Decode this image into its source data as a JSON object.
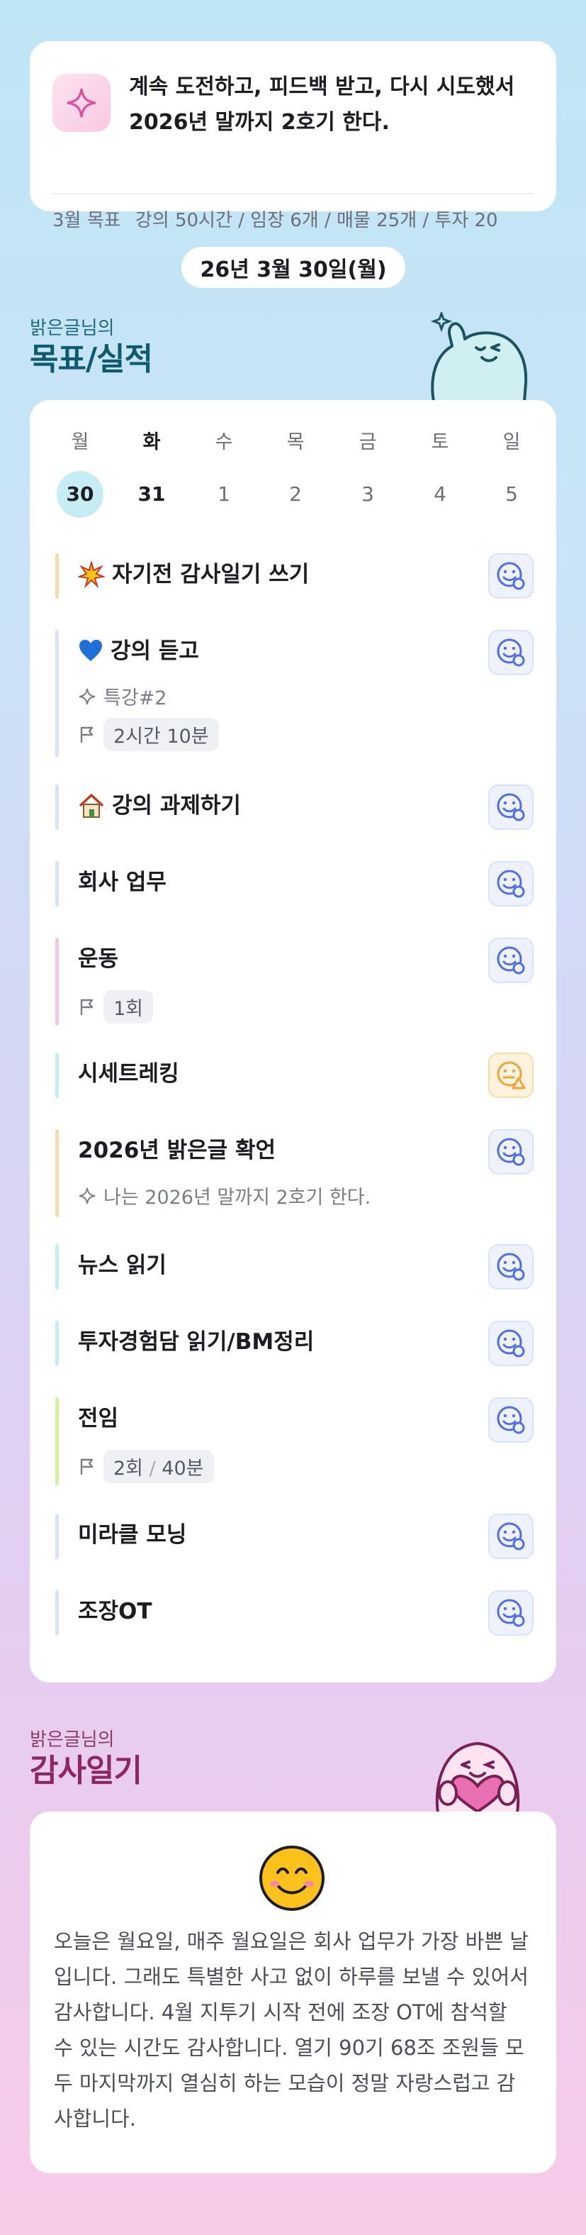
{
  "goal": {
    "text": "계속 도전하고, 피드백 받고, 다시 시도했서 2026년 말까지 2호기 한다.",
    "monthly_label": "3월 목표",
    "monthly_values": "강의 50시간 / 임장 6개 / 매물 25개 / 투자 20"
  },
  "date": "26년 3월 30일(월)",
  "goals_section": {
    "owner": "밝은글님의",
    "title": "목표/실적"
  },
  "week": {
    "days": [
      "월",
      "화",
      "수",
      "목",
      "금",
      "토",
      "일"
    ],
    "dates": [
      "30",
      "31",
      "1",
      "2",
      "3",
      "4",
      "5"
    ]
  },
  "tasks": [
    {
      "title": "자기전 감사일기 쓰기",
      "bar_color": "#f6dcaa",
      "status": "ok"
    },
    {
      "title": "강의 듣고",
      "sub": "특강#2",
      "chip": "2시간 10분",
      "bar_color": "#d9e1fb",
      "status": "ok"
    },
    {
      "title": "강의 과제하기",
      "bar_color": "#d9e1fb",
      "status": "ok"
    },
    {
      "title": "회사 업무",
      "bar_color": "#d9e1fb",
      "status": "ok"
    },
    {
      "title": "운동",
      "chip": "1회",
      "bar_color": "#f4c8e2",
      "status": "ok"
    },
    {
      "title": "시세트레킹",
      "bar_color": "#c6ecf4",
      "status": "warn"
    },
    {
      "title": "2026년 밝은글 확언",
      "sub": "나는 2026년 말까지 2호기 한다.",
      "bar_color": "#f6dcaa",
      "status": "ok"
    },
    {
      "title": "뉴스 읽기",
      "bar_color": "#c6ecf4",
      "status": "ok"
    },
    {
      "title": "투자경험담 읽기/BM정리",
      "bar_color": "#c6ecf4",
      "status": "ok"
    },
    {
      "title": "전임",
      "chip_a": "2회",
      "chip_sep": " / ",
      "chip_b": "40분",
      "bar_color": "#d6ef9c",
      "status": "ok"
    },
    {
      "title": "미라클 모닝",
      "bar_color": "#d9e1fb",
      "status": "ok"
    },
    {
      "title": "조장OT",
      "bar_color": "#d9e1fb",
      "status": "ok"
    }
  ],
  "diary_section": {
    "owner": "밝은글님의",
    "title": "감사일기"
  },
  "diary": {
    "emoji": "smiling-face-icon",
    "text": "오늘은 월요일, 매주 월요일은 회사 업무가 가장 바쁜 날입니다. 그래도 특별한 사고 없이 하루를 보낼 수 있어서 감사합니다. 4월 지투기 시작 전에 조장 OT에 참석할 수 있는 시간도 감사합니다. 열기 90기 68조 조원들 모두 마지막까지 열심히 하는 모습이 정말 자랑스럽고 감사합니다."
  },
  "colors": {
    "accent_teal": "#0f5a6e",
    "accent_pink": "#8a2764",
    "status_ok": "#4f6ee8",
    "status_warn": "#f0a43a"
  }
}
